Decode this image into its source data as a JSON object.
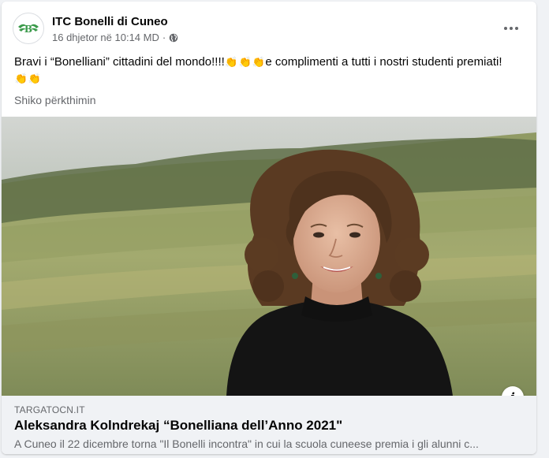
{
  "post": {
    "page_name": "ITC Bonelli di Cuneo",
    "timestamp": "16 dhjetor në 10:14 MD",
    "separator": "·",
    "audience_icon": "globe-icon",
    "avatar_letter": "B",
    "text_part1": "Bravi i “Bonelliani” cittadini del mondo!!!!",
    "text_part2": "e complimenti a tutti i nostri studenti premiati!",
    "clap_emoji": "👏",
    "see_translation": "Shiko përkthimin"
  },
  "link_preview": {
    "domain": "TARGATOCN.IT",
    "title": "Aleksandra Kolndrekaj “Bonelliana dell’Anno 2021\"",
    "description": "A Cuneo il 22 dicembre torna \"Il Bonelli incontra\" in cui la scuola cuneese premia i gli alunni c...",
    "info_label": "i"
  },
  "colors": {
    "secondary_text": "#65676b",
    "primary_text": "#050505",
    "link_bg": "#f0f2f5",
    "logo_green": "#3a9a4a"
  }
}
